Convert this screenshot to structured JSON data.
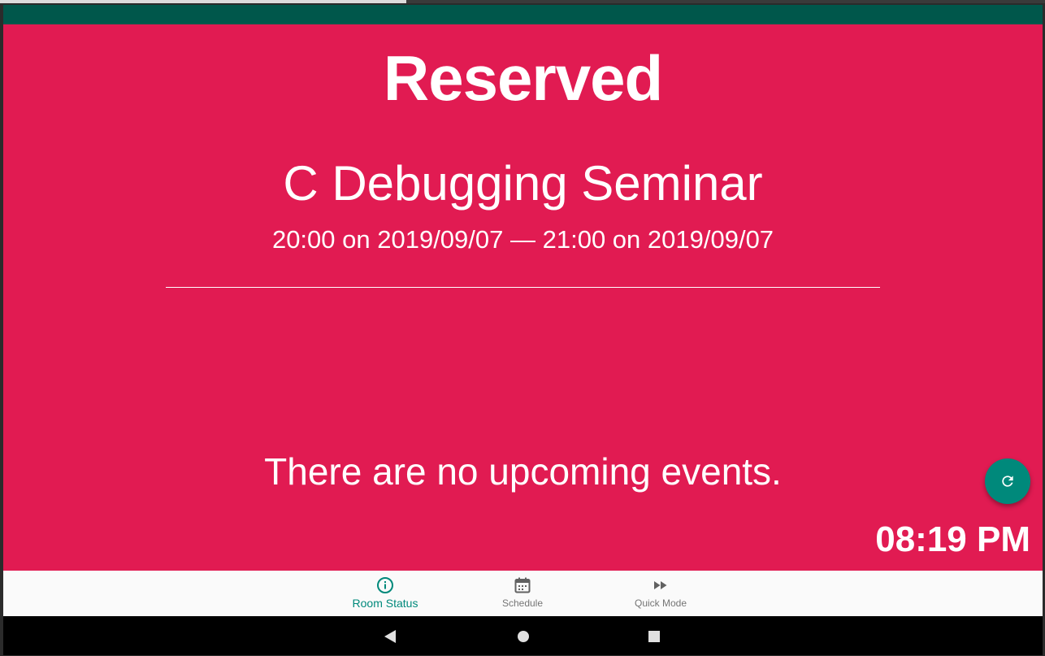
{
  "room": {
    "status": "Reserved",
    "event_title": "C Debugging Seminar",
    "event_time": "20:00 on 2019/09/07 — 21:00 on 2019/09/07",
    "upcoming_message": "There are no upcoming events.",
    "clock": "08:19 PM"
  },
  "bottom_nav": {
    "room_status": "Room Status",
    "schedule": "Schedule",
    "quick_mode": "Quick Mode"
  },
  "icons": {
    "refresh": "refresh-icon",
    "room_status": "info-icon",
    "schedule": "calendar-icon",
    "quick_mode": "fast-forward-icon",
    "back": "back-triangle-icon",
    "home": "home-circle-icon",
    "recents": "recents-square-icon"
  },
  "colors": {
    "status_bar": "#00574b",
    "reserved_background": "#e11b52",
    "accent": "#00897b",
    "nav_background": "#fafafa",
    "nav_inactive": "#757575",
    "text": "#ffffff"
  }
}
